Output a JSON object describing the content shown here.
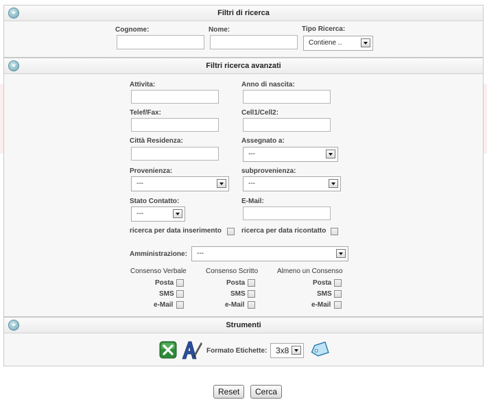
{
  "panels": {
    "basic_title": "Filtri di ricerca",
    "advanced_title": "Filtri ricerca avanzati",
    "tools_title": "Strumenti"
  },
  "basic": {
    "cognome_label": "Cognome:",
    "nome_label": "Nome:",
    "tipo_label": "Tipo Ricerca:",
    "tipo_value": "Contiene .."
  },
  "advanced": {
    "attivita_label": "Attivita:",
    "anno_label": "Anno di nascita:",
    "telef_label": "Telef/Fax:",
    "cell_label": "Cell1/Cell2:",
    "citta_label": "Città Residenza:",
    "assegnato_label": "Assegnato a:",
    "assegnato_value": "---",
    "provenienza_label": "Provenienza:",
    "provenienza_value": "---",
    "subprovenienza_label": "subprovenienza:",
    "subprovenienza_value": "---",
    "stato_label": "Stato Contatto:",
    "stato_value": "---",
    "email_label": "E-Mail:",
    "data_ins_label": "ricerca per data inserimento",
    "data_ricont_label": "ricerca per data ricontatto",
    "amministrazione_label": "Amministrazione:",
    "amministrazione_value": "---",
    "consensi": [
      {
        "title": "Consenso Verbale",
        "posta": "Posta",
        "sms": "SMS",
        "email": "e-Mail"
      },
      {
        "title": "Consenso Scritto",
        "posta": "Posta",
        "sms": "SMS",
        "email": "e-Mail"
      },
      {
        "title": "Almeno un Consenso",
        "posta": "Posta",
        "sms": "SMS",
        "email": "e-Mail"
      }
    ]
  },
  "tools": {
    "excel_icon": "excel-export-icon",
    "font_icon": "font-a-icon",
    "label_format_label": "Formato Etichette:",
    "label_format_value": "3x8",
    "tag_icon": "label-tag-icon"
  },
  "buttons": {
    "reset": "Reset",
    "cerca": "Cerca"
  }
}
